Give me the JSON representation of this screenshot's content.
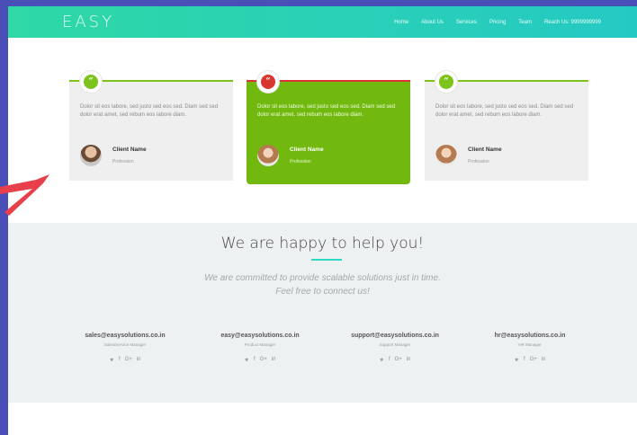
{
  "header": {
    "logo": "EASY",
    "nav": [
      "Home",
      "About Us",
      "Services",
      "Pricing",
      "Team",
      "Reach Us: 9999999999"
    ]
  },
  "testimonials": [
    {
      "icon": "“",
      "quote": "Dolor sit eos labore, sed justo sed eos sed. Diam sed sed dolor erat amet, sed rebum eos labore diam.",
      "name": "Client Name",
      "role": "Profession"
    },
    {
      "icon": "“",
      "quote": "Dolor sit eos labore, sed justo sed eos sed. Diam sed sed dolor erat amet, sed rebum eos labore diam.",
      "name": "Client Name",
      "role": "Profession"
    },
    {
      "icon": "“",
      "quote": "Dolor sit eos labore, sed justo sed eos sed. Diam sed sed dolor erat amet, sed rebum eos labore diam.",
      "name": "Client Name",
      "role": "Profession"
    }
  ],
  "help": {
    "title": "We are happy to help you!",
    "subtitle_1": "We are committed to provide scalable solutions just in time.",
    "subtitle_2": "Feel free to connect us!",
    "contacts": [
      {
        "email": "sales@easysolutions.co.in",
        "role": "Sales/Service Manager"
      },
      {
        "email": "easy@easysolutions.co.in",
        "role": "Product Manager"
      },
      {
        "email": "support@easysolutions.co.in",
        "role": "Support Manager"
      },
      {
        "email": "hr@easysolutions.co.in",
        "role": "HR Manager"
      }
    ],
    "social_icons": [
      "★",
      "f",
      "G+",
      "in"
    ]
  },
  "colors": {
    "brand_gradient_start": "#2fd8a6",
    "brand_gradient_end": "#25c9c4",
    "green": "#71b80f",
    "red": "#d9362f"
  }
}
